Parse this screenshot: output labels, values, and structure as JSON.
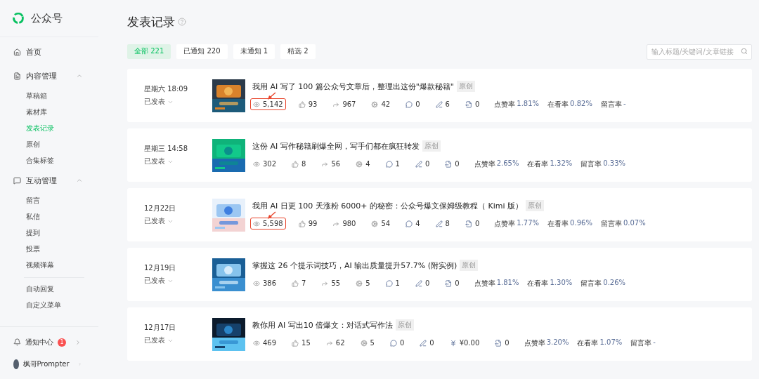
{
  "brand": {
    "name": "公众号"
  },
  "sidebar": {
    "sections": [
      {
        "kind": "link",
        "label": "首页"
      },
      {
        "kind": "group",
        "label": "内容管理",
        "expanded": true,
        "children": [
          {
            "label": "草稿箱",
            "selected": false
          },
          {
            "label": "素材库",
            "selected": false
          },
          {
            "label": "发表记录",
            "selected": true
          },
          {
            "label": "原创",
            "selected": false
          },
          {
            "label": "合集标签",
            "selected": false
          }
        ]
      },
      {
        "kind": "group",
        "label": "互动管理",
        "expanded": true,
        "children": [
          {
            "label": "留言",
            "selected": false
          },
          {
            "label": "私信",
            "selected": false
          },
          {
            "label": "提到",
            "selected": false
          },
          {
            "label": "投票",
            "selected": false
          },
          {
            "label": "视频弹幕",
            "selected": false
          }
        ]
      },
      {
        "kind": "plain",
        "children": [
          {
            "label": "自动回复",
            "selected": false
          },
          {
            "label": "自定义菜单",
            "selected": false
          }
        ]
      }
    ],
    "footer": [
      {
        "kind": "notify",
        "label": "通知中心",
        "badge": "1"
      },
      {
        "kind": "user",
        "label": "枫哥Prompter"
      }
    ]
  },
  "page": {
    "title": "发表记录"
  },
  "tabs": [
    {
      "label": "全部 221",
      "selected": true
    },
    {
      "label": "已通知 220",
      "selected": false
    },
    {
      "label": "未通知 1",
      "selected": false
    },
    {
      "label": "精选 2",
      "selected": false
    }
  ],
  "search": {
    "placeholder": "输入标题/关键词/文章链接"
  },
  "articles": [
    {
      "date": "星期六 18:09",
      "status": "已发表",
      "title": "我用 AI 写了 100 篇公众号文章后，整理出这份\"爆款秘籍\"",
      "tag": "原创",
      "stats": [
        {
          "kind": "view",
          "value": "5,142",
          "highlighted": true
        },
        {
          "kind": "like",
          "value": "93"
        },
        {
          "kind": "share",
          "value": "967"
        },
        {
          "kind": "wow",
          "value": "42"
        },
        {
          "kind": "comment",
          "value": "0"
        },
        {
          "kind": "note",
          "value": "6"
        },
        {
          "kind": "export",
          "value": "0"
        }
      ],
      "rates": [
        {
          "label": "点赞率",
          "value": "1.81%"
        },
        {
          "label": "在看率",
          "value": "0.82%"
        },
        {
          "label": "留言率",
          "value": "-"
        }
      ]
    },
    {
      "date": "星期三 14:58",
      "status": "已发表",
      "title": "这份 AI 写作秘籍刷爆全网，写手们都在疯狂转发",
      "tag": "原创",
      "stats": [
        {
          "kind": "view",
          "value": "302",
          "highlighted": false
        },
        {
          "kind": "like",
          "value": "8"
        },
        {
          "kind": "share",
          "value": "56"
        },
        {
          "kind": "wow",
          "value": "4"
        },
        {
          "kind": "comment",
          "value": "1"
        },
        {
          "kind": "note",
          "value": "0"
        },
        {
          "kind": "export",
          "value": "0"
        }
      ],
      "rates": [
        {
          "label": "点赞率",
          "value": "2.65%"
        },
        {
          "label": "在看率",
          "value": "1.32%"
        },
        {
          "label": "留言率",
          "value": "0.33%"
        }
      ]
    },
    {
      "date": "12月22日",
      "status": "已发表",
      "title": "我用 AI 日更 100 天涨粉 6000+ 的秘密：公众号爆文保姆级教程（ Kimi 版）",
      "tag": "原创",
      "stats": [
        {
          "kind": "view",
          "value": "5,598",
          "highlighted": true
        },
        {
          "kind": "like",
          "value": "99"
        },
        {
          "kind": "share",
          "value": "980"
        },
        {
          "kind": "wow",
          "value": "54"
        },
        {
          "kind": "comment",
          "value": "4"
        },
        {
          "kind": "note",
          "value": "8"
        },
        {
          "kind": "export",
          "value": "0"
        }
      ],
      "rates": [
        {
          "label": "点赞率",
          "value": "1.77%"
        },
        {
          "label": "在看率",
          "value": "0.96%"
        },
        {
          "label": "留言率",
          "value": "0.07%"
        }
      ]
    },
    {
      "date": "12月19日",
      "status": "已发表",
      "title": "掌握这 26 个提示词技巧，AI 输出质量提升57.7% (附实例)",
      "tag": "原创",
      "stats": [
        {
          "kind": "view",
          "value": "386",
          "highlighted": false
        },
        {
          "kind": "like",
          "value": "7"
        },
        {
          "kind": "share",
          "value": "55"
        },
        {
          "kind": "wow",
          "value": "5"
        },
        {
          "kind": "comment",
          "value": "1"
        },
        {
          "kind": "note",
          "value": "0"
        },
        {
          "kind": "export",
          "value": "0"
        }
      ],
      "rates": [
        {
          "label": "点赞率",
          "value": "1.81%"
        },
        {
          "label": "在看率",
          "value": "1.30%"
        },
        {
          "label": "留言率",
          "value": "0.26%"
        }
      ]
    },
    {
      "date": "12月17日",
      "status": "已发表",
      "title": "教你用 AI 写出10 倍爆文：对话式写作法",
      "tag": "原创",
      "stats": [
        {
          "kind": "view",
          "value": "469",
          "highlighted": false
        },
        {
          "kind": "like",
          "value": "15"
        },
        {
          "kind": "share",
          "value": "62"
        },
        {
          "kind": "wow",
          "value": "5"
        },
        {
          "kind": "comment",
          "value": "0"
        },
        {
          "kind": "note",
          "value": "0"
        },
        {
          "kind": "reward",
          "value": "¥0.00"
        },
        {
          "kind": "export",
          "value": "0"
        }
      ],
      "rates": [
        {
          "label": "点赞率",
          "value": "3.20%"
        },
        {
          "label": "在看率",
          "value": "1.07%"
        },
        {
          "label": "留言率",
          "value": "-"
        }
      ]
    }
  ]
}
